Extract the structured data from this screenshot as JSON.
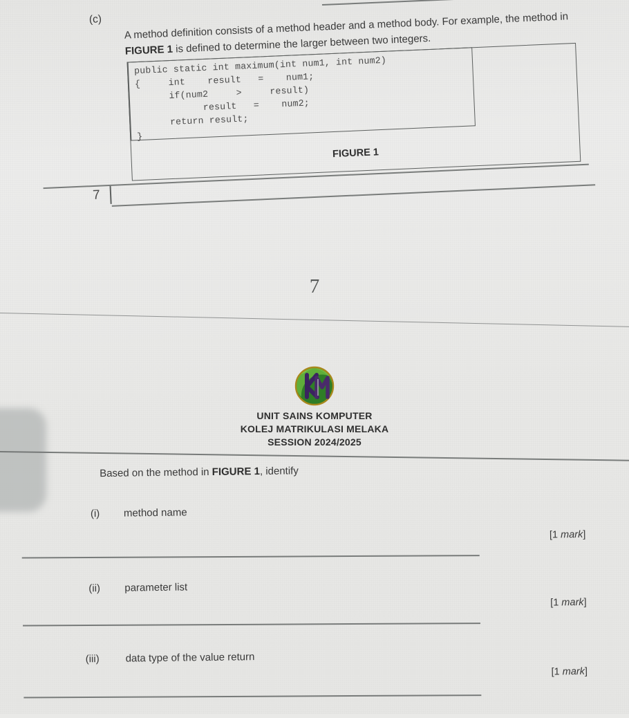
{
  "page": {
    "background_color": "#e8e8e6",
    "ink_color": "#3a3a3a",
    "page_number_center": "7",
    "page_break_marker": "7"
  },
  "question_c": {
    "label": "(c)",
    "text_part1": "A method definition consists of a method header and a method body. For example, the method in ",
    "figure_ref": "FIGURE 1",
    "text_part2": " is defined to determine the larger between two integers.",
    "figure_caption": "FIGURE 1",
    "code": "public static int maximum(int num1, int num2)\n{     int    result   =    num1;\n      if(num2     >     result)\n            result   =    num2;\n      return result;\n}"
  },
  "stamp": {
    "logo_name": "km-college-logo",
    "logo_colors": {
      "green": "#3f8f2e",
      "dark_green": "#1f6b22",
      "purple": "#4a2a6b",
      "gold": "#b8941f"
    },
    "line1": "UNIT SAINS KOMPUTER",
    "line2": "KOLEJ MATRIKULASI MELAKA",
    "line3": "SESSION 2024/2025"
  },
  "question_bottom": {
    "intro_part1": "Based on the method in ",
    "intro_figure": "FIGURE 1",
    "intro_part2": ", identify",
    "items": [
      {
        "num": "(i)",
        "text": "method name",
        "marks_prefix": "[1 ",
        "marks_word": "mark",
        "marks_suffix": "]"
      },
      {
        "num": "(ii)",
        "text": "parameter list",
        "marks_prefix": "[1 ",
        "marks_word": "mark",
        "marks_suffix": "]"
      },
      {
        "num": "(iii)",
        "text": "data type of the value return",
        "marks_prefix": "[1 ",
        "marks_word": "mark",
        "marks_suffix": "]"
      }
    ]
  }
}
